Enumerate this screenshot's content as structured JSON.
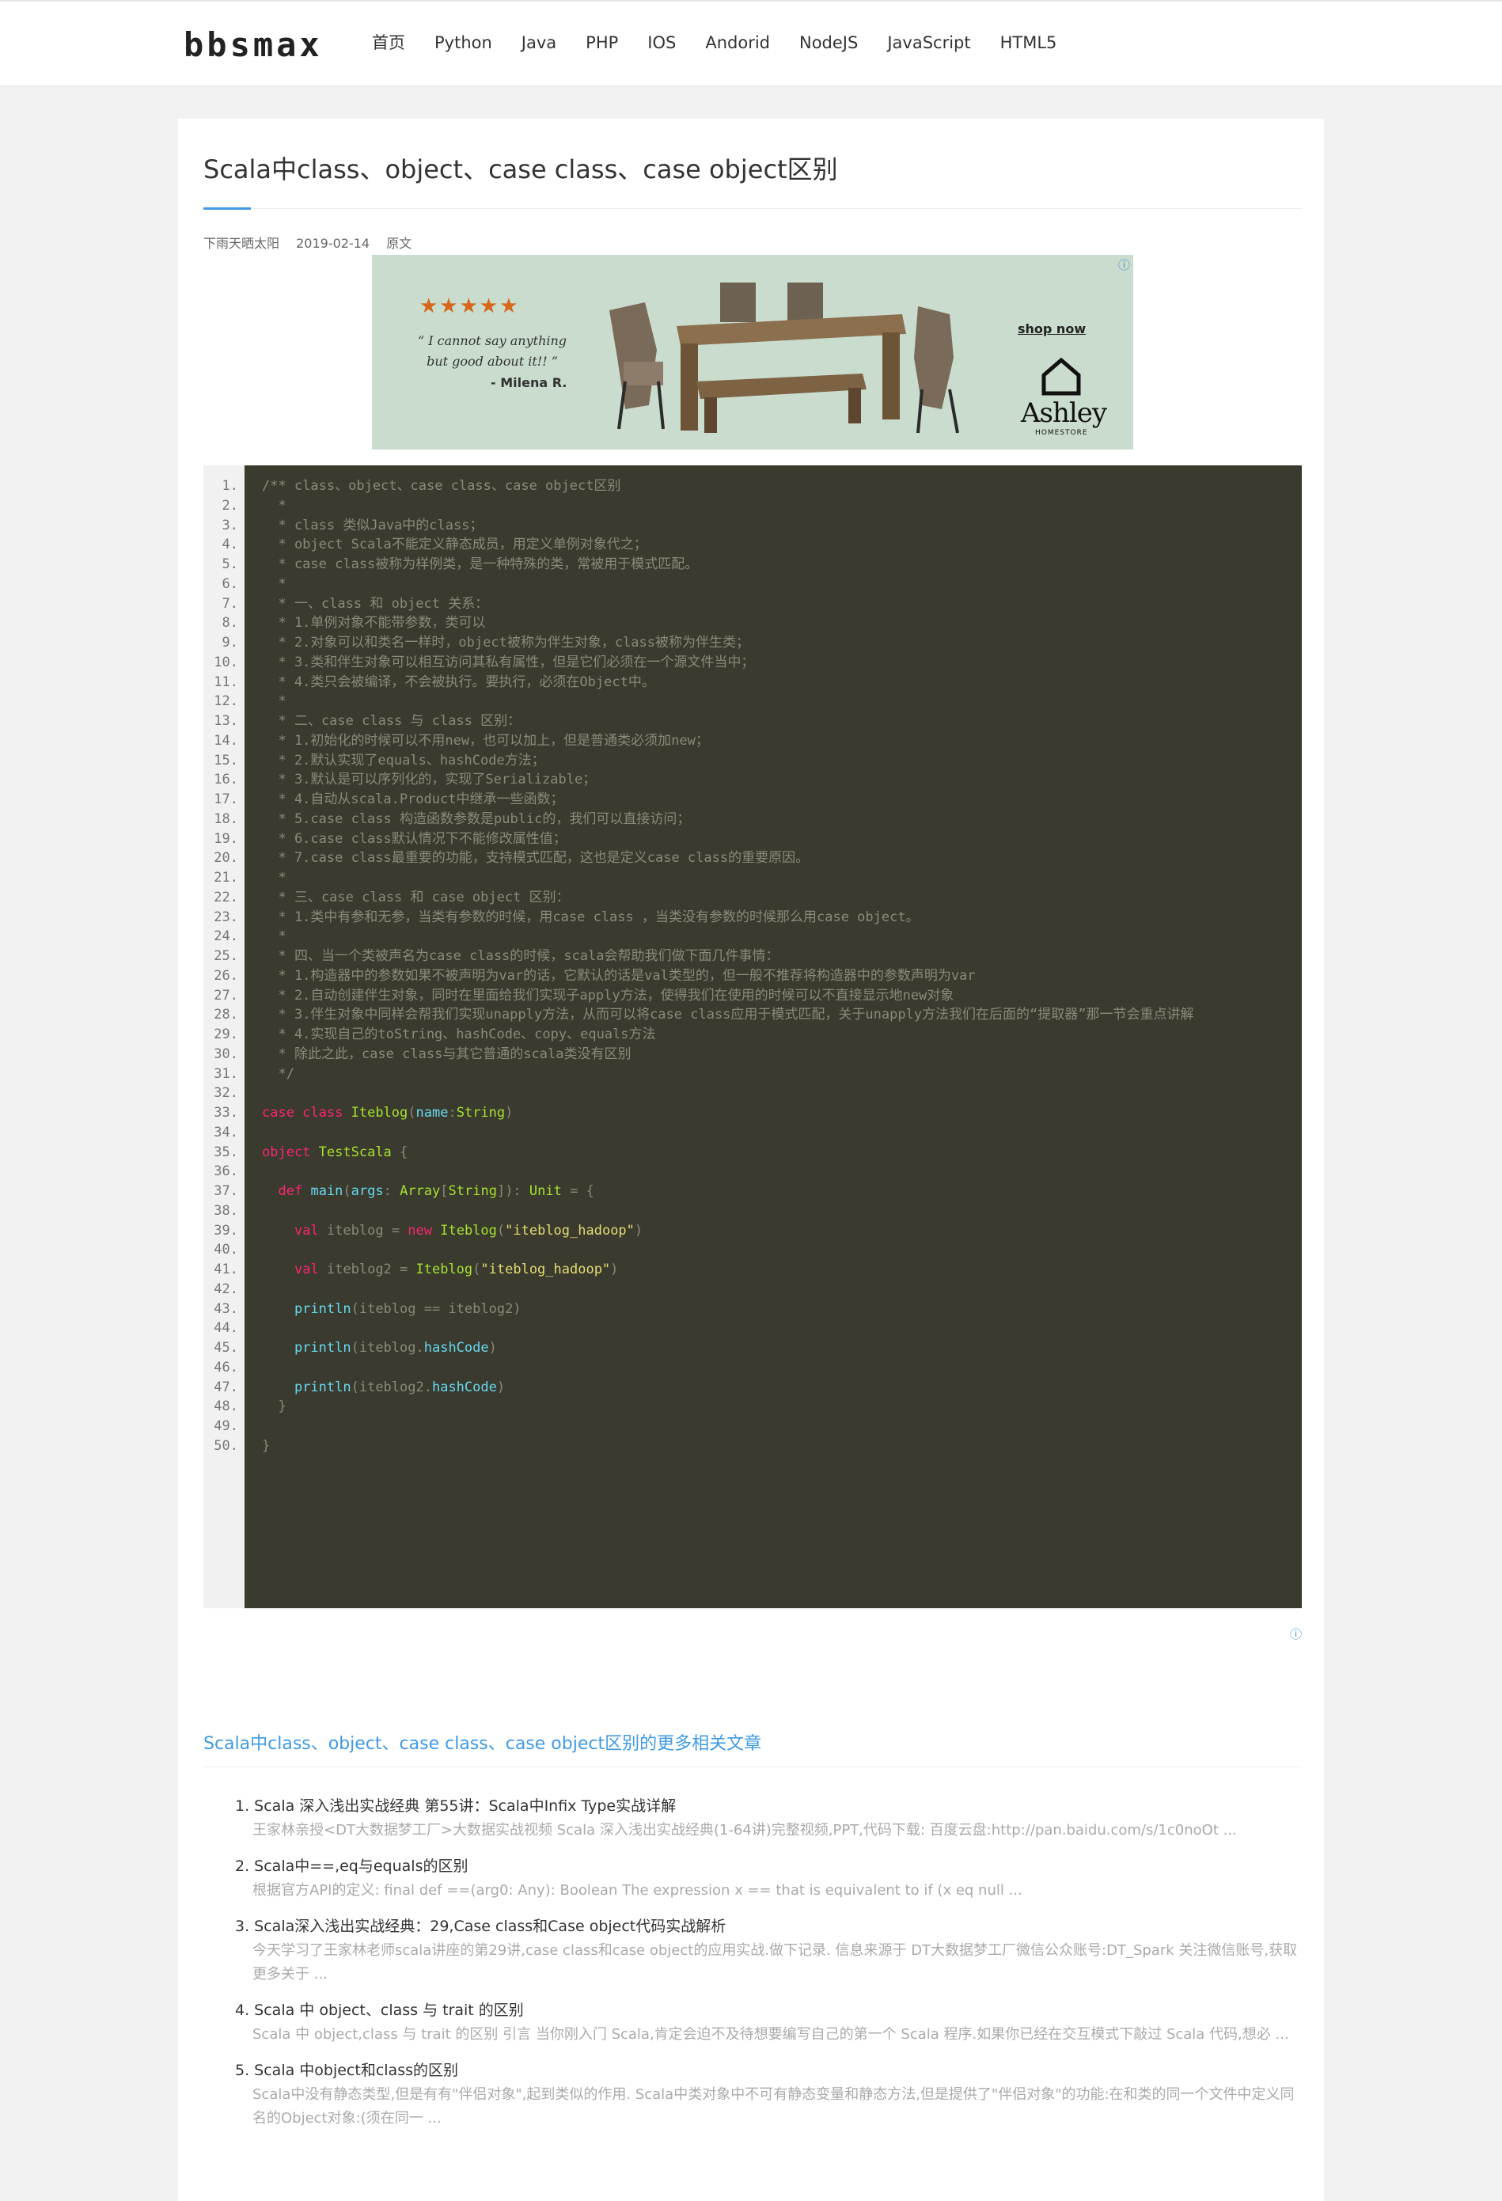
{
  "header": {
    "logo": "bbsmax",
    "nav": [
      "首页",
      "Python",
      "Java",
      "PHP",
      "IOS",
      "Andorid",
      "NodeJS",
      "JavaScript",
      "HTML5"
    ]
  },
  "article": {
    "title": "Scala中class、object、case class、case object区别",
    "author": "下雨天晒太阳",
    "date": "2019-02-14",
    "source_label": "原文"
  },
  "ad_top": {
    "info": "ⓘ",
    "stars": "★★★★★",
    "quote": "“ I cannot say anything but good about it!! ”",
    "author": "- Milena R.",
    "shop": "shop now",
    "brand": "Ashley",
    "brand_sub": "HOMESTORE"
  },
  "code": {
    "lines": [
      "/** class、object、case class、case object区别",
      "  *",
      "  * class 类似Java中的class；",
      "  * object Scala不能定义静态成员，用定义单例对象代之；",
      "  * case class被称为样例类，是一种特殊的类，常被用于模式匹配。",
      "  *",
      "  * 一、class 和 object 关系：",
      "  * 1.单例对象不能带参数，类可以",
      "  * 2.对象可以和类名一样时，object被称为伴生对象，class被称为伴生类；",
      "  * 3.类和伴生对象可以相互访问其私有属性，但是它们必须在一个源文件当中；",
      "  * 4.类只会被编译，不会被执行。要执行，必须在Object中。",
      "  *",
      "  * 二、case class 与 class 区别：",
      "  * 1.初始化的时候可以不用new，也可以加上，但是普通类必须加new；",
      "  * 2.默认实现了equals、hashCode方法；",
      "  * 3.默认是可以序列化的，实现了Serializable；",
      "  * 4.自动从scala.Product中继承一些函数；",
      "  * 5.case class 构造函数参数是public的，我们可以直接访问；",
      "  * 6.case class默认情况下不能修改属性值；",
      "  * 7.case class最重要的功能，支持模式匹配，这也是定义case class的重要原因。",
      "  *",
      "  * 三、case class 和 case object 区别：",
      "  * 1.类中有参和无参，当类有参数的时候，用case class ，当类没有参数的时候那么用case object。",
      "  *",
      "  * 四、当一个类被声名为case class的时候，scala会帮助我们做下面几件事情：",
      "  * 1.构造器中的参数如果不被声明为var的话，它默认的话是val类型的，但一般不推荐将构造器中的参数声明为var",
      "  * 2.自动创建伴生对象，同时在里面给我们实现子apply方法，使得我们在使用的时候可以不直接显示地new对象",
      "  * 3.伴生对象中同样会帮我们实现unapply方法，从而可以将case class应用于模式匹配，关于unapply方法我们在后面的“提取器”那一节会重点讲解",
      "  * 4.实现自己的toString、hashCode、copy、equals方法",
      "  * 除此之此，case class与其它普通的scala类没有区别",
      "  */",
      "",
      "case class Iteblog(name:String)",
      "",
      "object TestScala {",
      "",
      "  def main(args: Array[String]): Unit = {",
      "",
      "    val iteblog = new Iteblog(\"iteblog_hadoop\")",
      "",
      "    val iteblog2 = Iteblog(\"iteblog_hadoop\")",
      "",
      "    println(iteblog == iteblog2)",
      "",
      "    println(iteblog.hashCode)",
      "",
      "    println(iteblog2.hashCode)",
      "  }",
      "",
      "}"
    ]
  },
  "ad_bottom": {
    "info": "ⓘ"
  },
  "related": {
    "title": "Scala中class、object、case class、case object区别的更多相关文章",
    "items": [
      {
        "num": "1.",
        "title": "Scala 深入浅出实战经典 第55讲：Scala中Infix Type实战详解",
        "desc": "王家林亲授<DT大数据梦工厂>大数据实战视频 Scala 深入浅出实战经典(1-64讲)完整视频,PPT,代码下载: 百度云盘:http://pan.baidu.com/s/1c0noOt ..."
      },
      {
        "num": "2.",
        "title": "Scala中==,eq与equals的区别",
        "desc": "根据官方API的定义: final def ==(arg0: Any): Boolean The expression x == that is equivalent to if (x eq null ..."
      },
      {
        "num": "3.",
        "title": "Scala深入浅出实战经典：29,Case class和Case object代码实战解析",
        "desc": "今天学习了王家林老师scala讲座的第29讲,case class和case object的应用实战.做下记录. 信息来源于 DT大数据梦工厂微信公众账号:DT_Spark 关注微信账号,获取更多关于 ..."
      },
      {
        "num": "4.",
        "title": "Scala 中 object、class 与 trait 的区别",
        "desc": "Scala 中 object,class 与 trait 的区别 引言 当你刚入门 Scala,肯定会迫不及待想要编写自己的第一个 Scala 程序.如果你已经在交互模式下敲过 Scala 代码,想必 ..."
      },
      {
        "num": "5.",
        "title": "Scala 中object和class的区别",
        "desc": "Scala中没有静态类型,但是有有\"伴侣对象\",起到类似的作用. Scala中类对象中不可有静态变量和静态方法,但是提供了\"伴侣对象\"的功能:在和类的同一个文件中定义同名的Object对象:(须在同一 ..."
      }
    ]
  }
}
